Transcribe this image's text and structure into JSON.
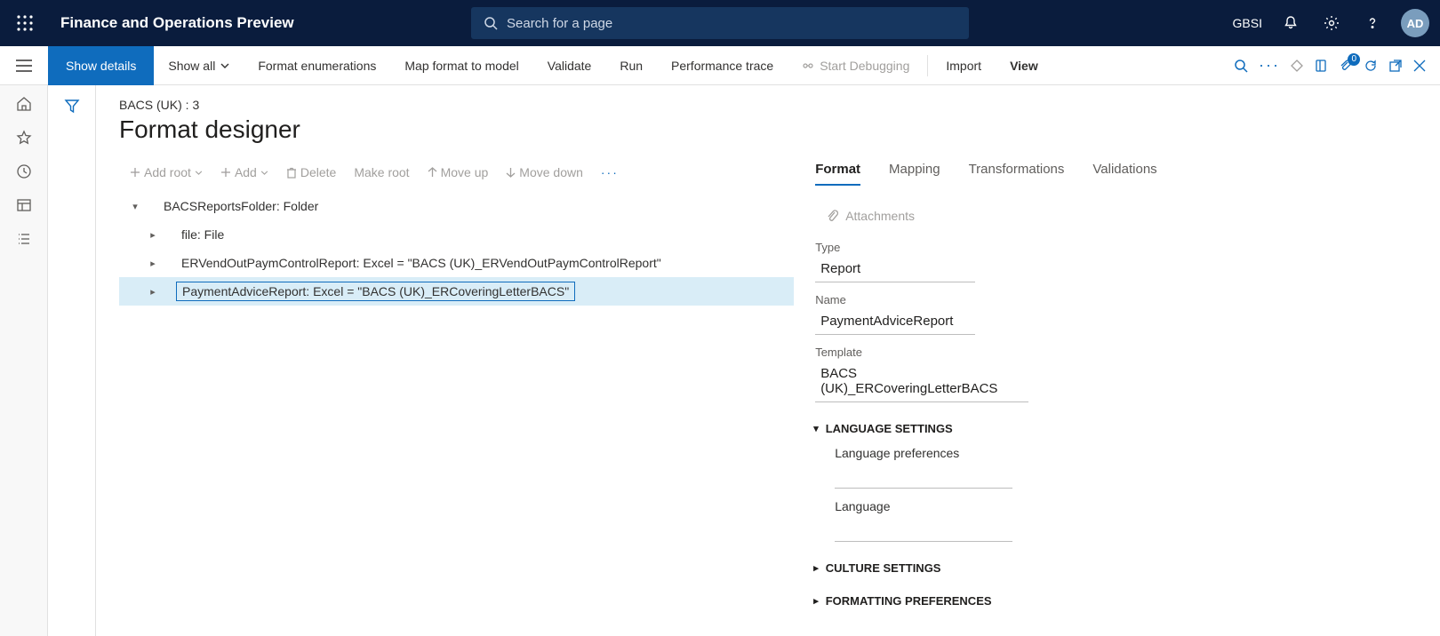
{
  "topbar": {
    "app_title": "Finance and Operations Preview",
    "search_placeholder": "Search for a page",
    "company": "GBSI",
    "avatar_initials": "AD"
  },
  "actionbar": {
    "primary": "Show details",
    "show_all": "Show all",
    "format_enums": "Format enumerations",
    "map_format": "Map format to model",
    "validate": "Validate",
    "run": "Run",
    "perf_trace": "Performance trace",
    "start_debug": "Start Debugging",
    "import": "Import",
    "view": "View",
    "attach_badge": "0"
  },
  "page": {
    "breadcrumb": "BACS (UK) : 3",
    "title": "Format designer"
  },
  "tree_toolbar": {
    "add_root": "Add root",
    "add": "Add",
    "delete": "Delete",
    "make_root": "Make root",
    "move_up": "Move up",
    "move_down": "Move down"
  },
  "tree": {
    "root": "BACSReportsFolder: Folder",
    "node1": "file: File",
    "node2": "ERVendOutPaymControlReport: Excel = \"BACS (UK)_ERVendOutPaymControlReport\"",
    "node3": "PaymentAdviceReport: Excel = \"BACS (UK)_ERCoveringLetterBACS\""
  },
  "prop_tabs": {
    "format": "Format",
    "mapping": "Mapping",
    "transformations": "Transformations",
    "validations": "Validations"
  },
  "attachments": {
    "label": "Attachments"
  },
  "fields": {
    "type_label": "Type",
    "type_value": "Report",
    "name_label": "Name",
    "name_value": "PaymentAdviceReport",
    "template_label": "Template",
    "template_value": "BACS (UK)_ERCoveringLetterBACS"
  },
  "sections": {
    "lang_settings": "LANGUAGE SETTINGS",
    "lang_prefs": "Language preferences",
    "language": "Language",
    "culture": "CULTURE SETTINGS",
    "formatting": "FORMATTING PREFERENCES"
  }
}
